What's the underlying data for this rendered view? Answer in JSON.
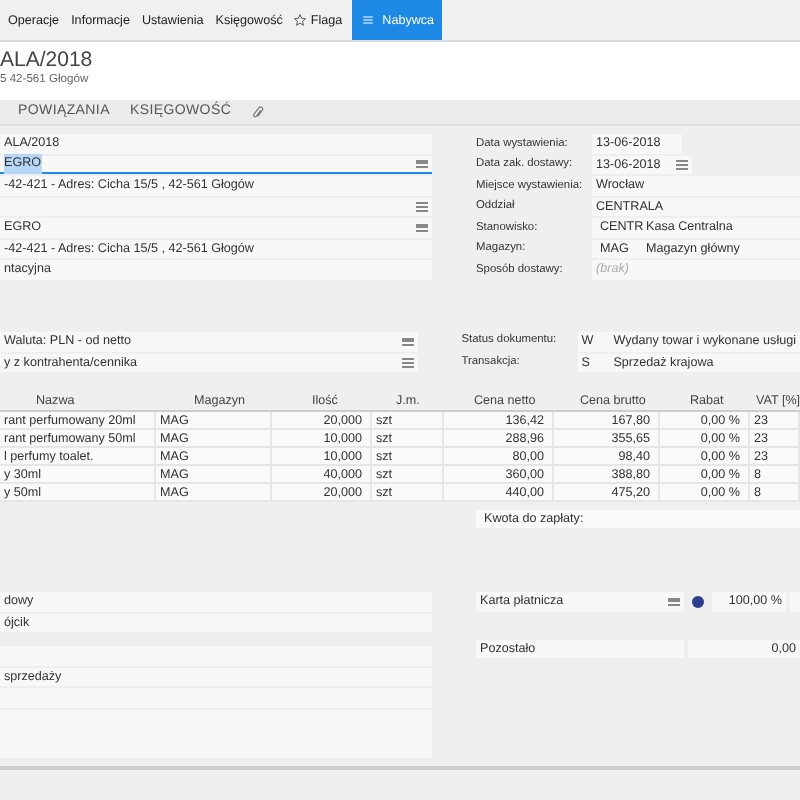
{
  "menu": [
    {
      "label": "Operacje",
      "kind": "plain",
      "selected": false
    },
    {
      "label": "Informacje",
      "kind": "plain",
      "selected": false
    },
    {
      "label": "Ustawienia",
      "kind": "plain",
      "selected": false
    },
    {
      "label": "Księgowość",
      "kind": "plain",
      "selected": false
    },
    {
      "label": "Flaga",
      "kind": "star",
      "selected": false
    },
    {
      "label": "Nabywca",
      "kind": "list",
      "selected": true
    }
  ],
  "document": {
    "title": "ALA/2018",
    "subtitle": "5 42-561 Głogów"
  },
  "tabs": [
    {
      "label": "POWIĄZANIA",
      "selected": false
    },
    {
      "label": "KSIĘGOWOŚĆ",
      "selected": false
    }
  ],
  "left_fields": [
    {
      "value": "ALA/2018",
      "focused": false,
      "button": false
    },
    {
      "value": "EGRO",
      "focused": true,
      "button": true
    },
    {
      "value": "-42-421  -  Adres:  Cicha  15/5 , 42-561 Głogów",
      "focused": false,
      "button": false
    },
    {
      "focused": false,
      "button": true
    },
    {
      "value": "EGRO",
      "focused": false,
      "button": true
    },
    {
      "value": "-42-421  -  Adres:  Cicha  15/5 , 42-561 Głogów",
      "focused": false,
      "button": false
    },
    {
      "value": "ntacyjna",
      "focused": false,
      "button": false
    }
  ],
  "right_fields": [
    {
      "label": "Data wystawienia:",
      "value": "13-06-2018",
      "kind": "date",
      "button": false
    },
    {
      "label": "Data zak. dostawy:",
      "value": "13-06-2018",
      "kind": "date",
      "button": true
    },
    {
      "label": "Miejsce wystawienia:",
      "value": "Wrocław",
      "kind": "text",
      "button": false
    },
    {
      "label": "Oddział",
      "value": "CENTRALA",
      "kind": "text",
      "button": false
    },
    {
      "label": "Stanowisko:",
      "code": "CENTR",
      "value": "Kasa Centralna",
      "kind": "coded",
      "button": false
    },
    {
      "label": "Magazyn:",
      "code": "MAG",
      "value": "Magazyn główny",
      "kind": "coded",
      "button": false
    },
    {
      "label": "Sposób dostawy:",
      "placeholder": "(brak)",
      "kind": "text",
      "button": false
    }
  ],
  "left_fields_2": [
    {
      "value": "Waluta: PLN - od netto",
      "button": true
    },
    {
      "value": "y z kontrahenta/cennika",
      "button": true
    }
  ],
  "right_fields_2": [
    {
      "label": "Status dokumentu:",
      "code": "W",
      "value": "Wydany towar i wykonane usługi"
    },
    {
      "label": "Transakcja:",
      "code": "S",
      "value": "Sprzedaż krajowa"
    }
  ],
  "table": {
    "columns": [
      "Nazwa",
      "Magazyn",
      "Ilość",
      "J.m.",
      "Cena netto",
      "Cena brutto",
      "Rabat",
      "VAT [%]"
    ],
    "rows": [
      [
        "rant perfumowany 20ml",
        "MAG",
        "20,000",
        "szt",
        "136,42",
        "167,80",
        "0,00 %",
        "23"
      ],
      [
        "rant perfumowany 50ml",
        "MAG",
        "10,000",
        "szt",
        "288,96",
        "355,65",
        "0,00 %",
        "23"
      ],
      [
        "l perfumy toalet.",
        "MAG",
        "10,000",
        "szt",
        "80,00",
        "98,40",
        "0,00 %",
        "23"
      ],
      [
        "y 30ml",
        "MAG",
        "40,000",
        "szt",
        "360,00",
        "388,80",
        "0,00 %",
        "8"
      ],
      [
        "y 50ml",
        "MAG",
        "20,000",
        "szt",
        "440,00",
        "475,20",
        "0,00 %",
        "8"
      ]
    ]
  },
  "amount_due": {
    "label": "Kwota do zapłaty:"
  },
  "bottom_fields": [
    [
      {
        "kind": "field",
        "value": "dowy"
      },
      {
        "kind": "field",
        "value": "ójcik"
      }
    ],
    [
      {
        "kind": "field"
      },
      {
        "kind": "field",
        "value": "sprzedaży"
      },
      {
        "kind": "field"
      },
      {
        "kind": "textarea"
      }
    ]
  ],
  "payments": [
    {
      "name": "Karta płatnicza",
      "color": "#2b3f8c",
      "share": "100,00 %"
    }
  ],
  "remaining": {
    "label": "Pozostało",
    "value": "0,00"
  }
}
